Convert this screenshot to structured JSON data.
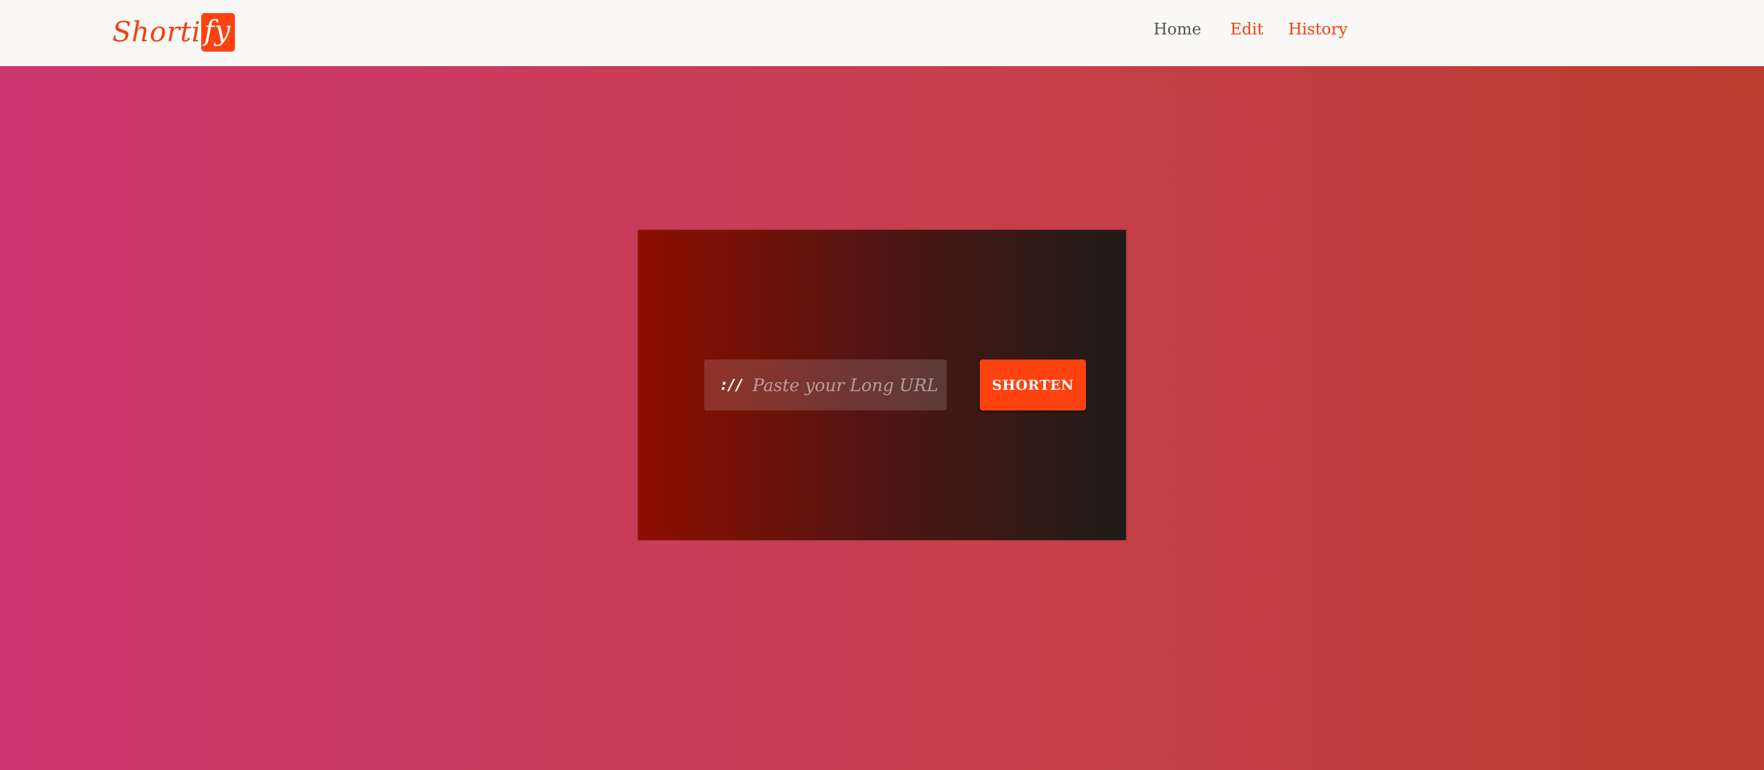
{
  "brand": {
    "name_prefix": "Shorti",
    "name_suffix": "fy"
  },
  "nav": {
    "items": [
      {
        "label": "Home"
      },
      {
        "label": "Edit"
      },
      {
        "label": "History"
      }
    ]
  },
  "form": {
    "icon": "link-icon",
    "icon_glyph": "://",
    "url_placeholder": "Paste your Long URL",
    "url_value": "",
    "submit_label": "SHORTEN"
  },
  "colors": {
    "accent": "#ff420f",
    "brand_text": "#ef4113",
    "nav_inactive": "#555555",
    "navbar_bg": "#f9f8f6"
  }
}
